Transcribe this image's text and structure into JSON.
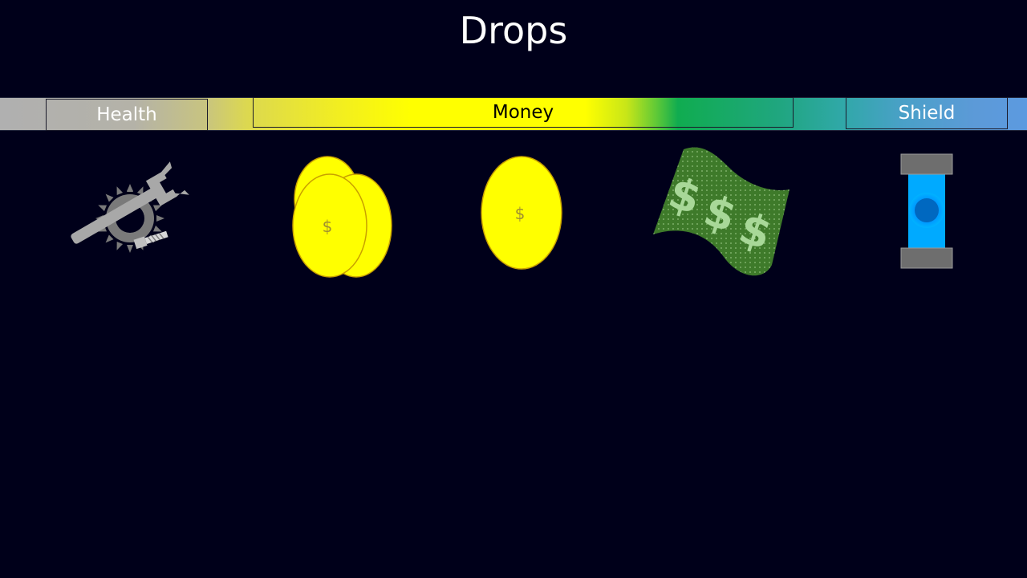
{
  "title": "Drops",
  "categories": [
    {
      "label": "Health"
    },
    {
      "label": "Money"
    },
    {
      "label": "Shield"
    }
  ],
  "items": [
    {
      "icon": "repair-kit-icon"
    },
    {
      "icon": "coin-stack-icon",
      "symbol": "$"
    },
    {
      "icon": "coin-icon",
      "symbol": "$"
    },
    {
      "icon": "banknote-icon",
      "symbol": "$"
    },
    {
      "icon": "shield-capsule-icon"
    }
  ],
  "colors": {
    "background": "#00001a",
    "coin": "#ffff00",
    "banknote": "#3e7a2a",
    "shield_core": "#00aaff",
    "metal": "#a0a0a0"
  }
}
